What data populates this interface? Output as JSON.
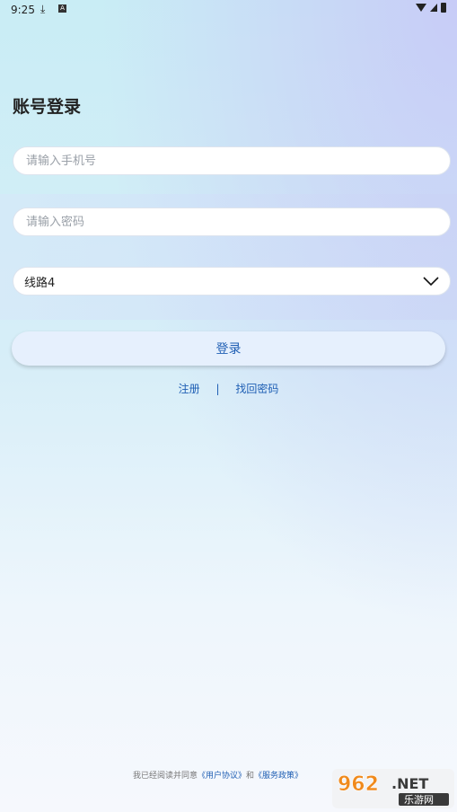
{
  "status_bar": {
    "time": "9:25",
    "download_icon": "download-icon",
    "notification_icon": "app-notification-icon",
    "wifi_icon": "wifi-icon",
    "signal_icon": "signal-icon",
    "battery_icon": "battery-icon"
  },
  "page": {
    "title": "账号登录"
  },
  "form": {
    "phone_placeholder": "请输入手机号",
    "password_placeholder": "请输入密码",
    "line_value": "线路4",
    "login_label": "登录"
  },
  "links": {
    "register": "注册",
    "separator": "|",
    "forgot": "找回密码"
  },
  "agreement": {
    "prefix": "我已经阅读并同意",
    "user_agreement": "《用户协议》",
    "and": "和",
    "service_policy": "《服务政策》"
  },
  "watermark": {
    "brand": "962.NET",
    "sub": "乐游网"
  },
  "colors": {
    "accent": "#1f5fb4",
    "button_bg": "#e6f0fd"
  }
}
